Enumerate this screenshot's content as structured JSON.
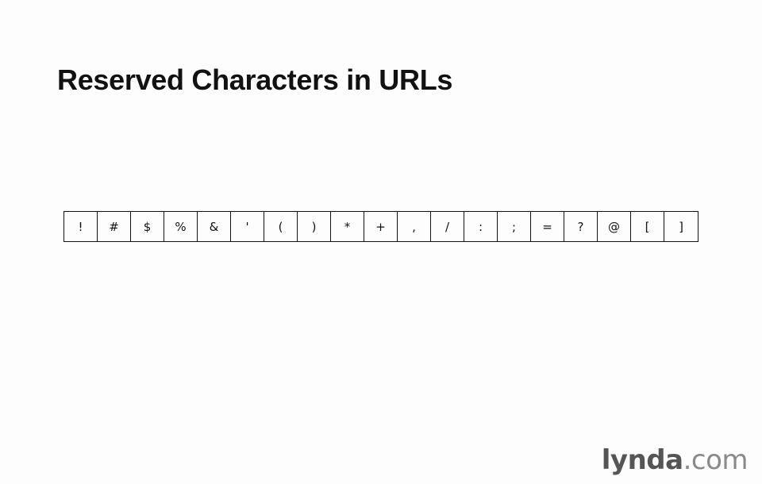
{
  "slide": {
    "title": "Reserved Characters in URLs"
  },
  "reserved_characters": [
    "!",
    "#",
    "$",
    "%",
    "&",
    "'",
    "(",
    ")",
    "*",
    "+",
    ",",
    "/",
    ":",
    ";",
    "=",
    "?",
    "@",
    "[",
    "]"
  ],
  "watermark": {
    "brand_main": "lynda",
    "brand_suffix": ".com"
  }
}
